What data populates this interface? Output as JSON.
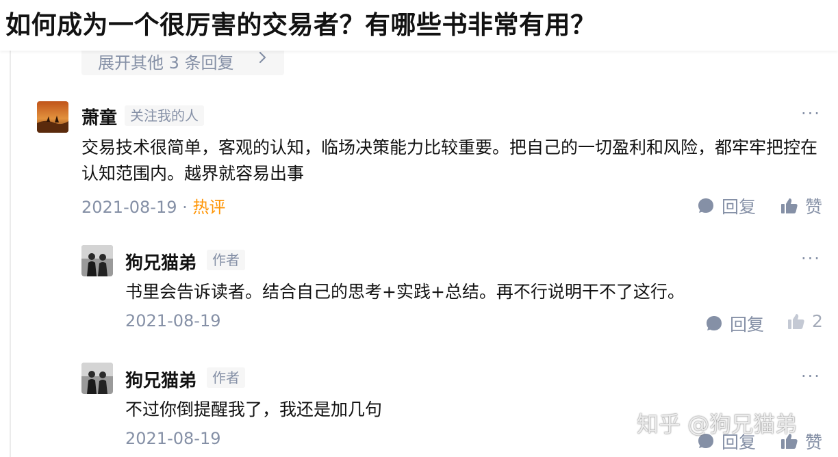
{
  "page": {
    "title": "如何成为一个很厉害的交易者？有哪些书非常有用？"
  },
  "expand": {
    "label": "展开其他 3 条回复"
  },
  "comments": [
    {
      "author": "萧童",
      "badge": "关注我的人",
      "text": "交易技术很简单，客观的认知，临场决策能力比较重要。把自己的一切盈利和风险，都牢牢把控在认知范围内。越界就容易出事",
      "date": "2021-08-19",
      "separator": " · ",
      "tag": "热评",
      "reply_label": "回复",
      "like_label": "赞",
      "more": "···"
    },
    {
      "author": "狗兄猫弟",
      "badge": "作者",
      "text": "书里会告诉读者。结合自己的思考+实践+总结。再不行说明干不了这行。",
      "date": "2021-08-19",
      "reply_label": "回复",
      "like_count": "2",
      "more": "···"
    },
    {
      "author": "狗兄猫弟",
      "badge": "作者",
      "text": "不过你倒提醒我了，我还是加几句",
      "date": "2021-08-19",
      "reply_label": "回复",
      "like_label": "赞",
      "more": "···"
    }
  ],
  "watermark": "知乎 @狗兄猫弟",
  "colors": {
    "meta_gray": "#8590a6",
    "hot_orange": "#ff9607",
    "text": "#121212",
    "chip_bg": "#f6f6f6"
  }
}
